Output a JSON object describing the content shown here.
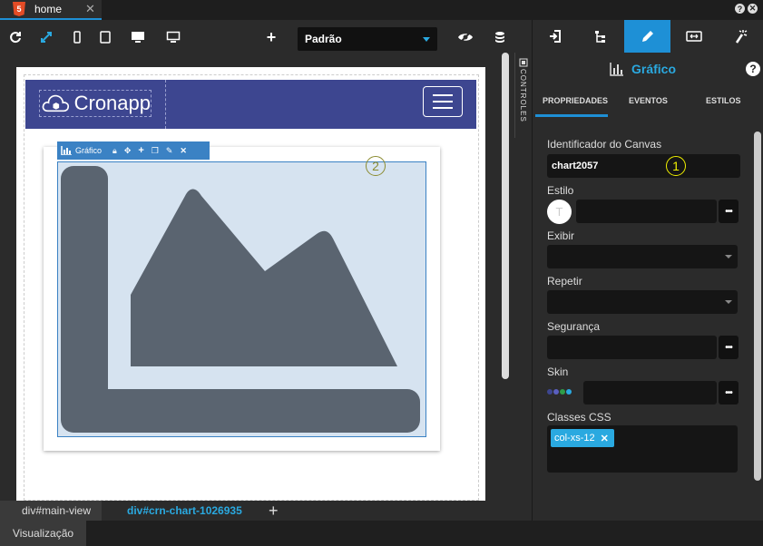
{
  "tabs": [
    {
      "label": "home",
      "close": "✕",
      "icon": "5"
    }
  ],
  "window_controls": {
    "help": "?",
    "close": "✕"
  },
  "toolbar": {
    "icons": [
      "refresh-icon",
      "expand-icon",
      "mobile-icon",
      "tablet-icon",
      "desktop-icon",
      "monitor-icon",
      "plus-icon",
      "eye-slash-icon",
      "database-icon"
    ],
    "select_value": "Padrão"
  },
  "canvas": {
    "logo_text": "Cronapp",
    "chart_toolbar_label": "Gráfico",
    "chart_toolbar_icons": [
      "lock-icon",
      "move-icon",
      "plus-icon",
      "copy-icon",
      "magic-icon",
      "close-icon"
    ],
    "marker_2": "2"
  },
  "controls_tab": "CONTROLES",
  "breadcrumb": [
    "div#main-view",
    "div#crn-chart-1026935"
  ],
  "breadcrumb_add": "+",
  "status_tab": "Visualização",
  "panel": {
    "tab_icons": [
      "enter-icon",
      "tree-icon",
      "pencil-icon",
      "resize-icon",
      "wand-icon"
    ],
    "title": "Gráfico",
    "help": "?",
    "subtabs": [
      "PROPRIEDADES",
      "EVENTOS",
      "ESTILOS"
    ],
    "marker_1": "1",
    "fields": {
      "canvas_id_label": "Identificador do Canvas",
      "canvas_id_value": "chart2057",
      "style_label": "Estilo",
      "style_badge": "T",
      "show_label": "Exibir",
      "repeat_label": "Repetir",
      "security_label": "Segurança",
      "skin_label": "Skin",
      "css_label": "Classes CSS",
      "css_chip": "col-xs-12",
      "dots": "•••"
    },
    "skin_colors": [
      "#3d4690",
      "#5a5fc0",
      "#2e9e4a",
      "#2aa9e0"
    ],
    "accent": "#1e90d6"
  }
}
